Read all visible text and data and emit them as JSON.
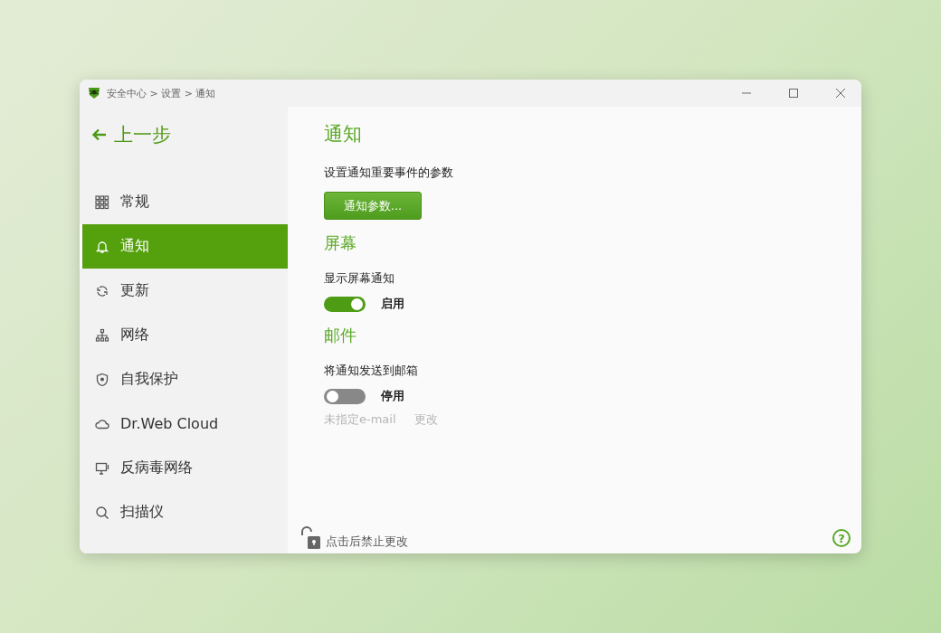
{
  "window": {
    "breadcrumb": "安全中心 > 设置 > 通知"
  },
  "back": {
    "label": "上一步"
  },
  "sidebar": {
    "items": [
      {
        "label": "常规",
        "selected": false
      },
      {
        "label": "通知",
        "selected": true
      },
      {
        "label": "更新",
        "selected": false
      },
      {
        "label": "网络",
        "selected": false
      },
      {
        "label": "自我保护",
        "selected": false
      },
      {
        "label": "Dr.Web Cloud",
        "selected": false
      },
      {
        "label": "反病毒网络",
        "selected": false
      },
      {
        "label": "扫描仪",
        "selected": false
      }
    ]
  },
  "content": {
    "title": "通知",
    "description": "设置通知重要事件的参数",
    "button": "通知参数...",
    "sections": [
      {
        "heading": "屏幕",
        "label": "显示屏幕通知",
        "toggle": {
          "on": true,
          "label": "启用"
        }
      },
      {
        "heading": "邮件",
        "label": "将通知发送到邮箱",
        "toggle": {
          "on": false,
          "label": "停用"
        },
        "email": "未指定e-mail",
        "change_link": "更改"
      }
    ]
  },
  "footer": {
    "lock_text": "点击后禁止更改",
    "help": "?"
  }
}
